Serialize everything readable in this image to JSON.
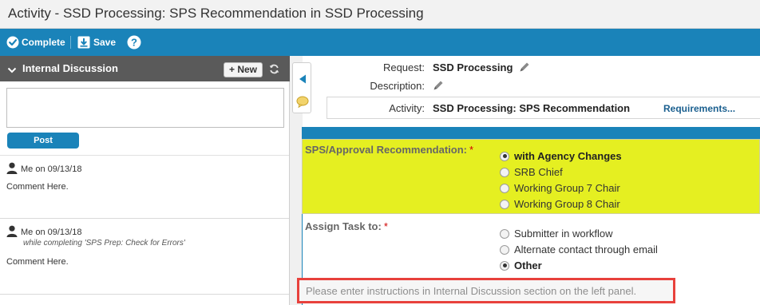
{
  "window": {
    "title": "Activity - SSD Processing: SPS Recommendation in SSD Processing"
  },
  "toolbar": {
    "complete_label": "Complete",
    "save_label": "Save"
  },
  "discussion": {
    "title": "Internal Discussion",
    "new_label": "+ New",
    "comment_value": "",
    "post_label": "Post",
    "entries": [
      {
        "author": "Me on 09/13/18",
        "context": "",
        "body": "Comment Here."
      },
      {
        "author": "Me on 09/13/18",
        "context": "while completing 'SPS Prep: Check for Errors'",
        "body": "Comment Here."
      }
    ]
  },
  "info": {
    "request_label": "Request:",
    "request_value": "SSD Processing",
    "description_label": "Description:",
    "description_value": "",
    "activity_label": "Activity:",
    "activity_value": "SSD Processing: SPS Recommendation",
    "requirements_link": "Requirements..."
  },
  "form": {
    "q1": {
      "label": "SPS/Approval Recommendation:",
      "required": "*",
      "options": [
        {
          "label": "with Agency Changes",
          "selected": true
        },
        {
          "label": "SRB Chief",
          "selected": false
        },
        {
          "label": "Working Group 7 Chair",
          "selected": false
        },
        {
          "label": "Working Group 8 Chair",
          "selected": false
        }
      ]
    },
    "q2": {
      "label": "Assign Task to:",
      "required": "*",
      "options": [
        {
          "label": "Submitter in workflow",
          "selected": false
        },
        {
          "label": "Alternate contact through email",
          "selected": false
        },
        {
          "label": "Other",
          "selected": true
        }
      ]
    },
    "hint": "Please enter instructions in Internal Discussion section on the left panel."
  },
  "colors": {
    "toolbar": "#1a83b9",
    "highlight": "#e5ef21",
    "annotation": "#e8413c"
  }
}
